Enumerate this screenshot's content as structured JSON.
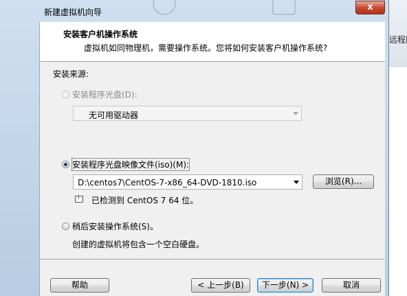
{
  "window": {
    "title": "新建虚拟机向导",
    "close_glyph": "x"
  },
  "background": {
    "partial_text": "远程服"
  },
  "header": {
    "title": "安装客户机操作系统",
    "subtitle": "虚拟机如同物理机，需要操作系统。您将如何安装客户机操作系统?"
  },
  "source": {
    "label": "安装来源:",
    "options": [
      {
        "label": "安装程序光盘(D):",
        "selected": false,
        "enabled": false,
        "combo_value": "无可用驱动器"
      },
      {
        "label": "安装程序光盘映像文件(iso)(M):",
        "selected": true,
        "enabled": true,
        "combo_value": "D:\\centos7\\CentOS-7-x86_64-DVD-1810.iso",
        "browse_label": "浏览(R)...",
        "detected_text": "已检测到 CentOS 7 64 位。"
      },
      {
        "label": "稍后安装操作系统(S)。",
        "selected": false,
        "enabled": true,
        "description": "创建的虚拟机将包含一个空白硬盘。"
      }
    ]
  },
  "footer": {
    "help": "帮助",
    "back": "< 上一步(B)",
    "next": "下一步(N) >",
    "cancel": "取消"
  },
  "colors": {
    "dialog_frame": "#b8cde3",
    "close_button": "#c7452c",
    "default_button_border": "#3c7fb1"
  }
}
